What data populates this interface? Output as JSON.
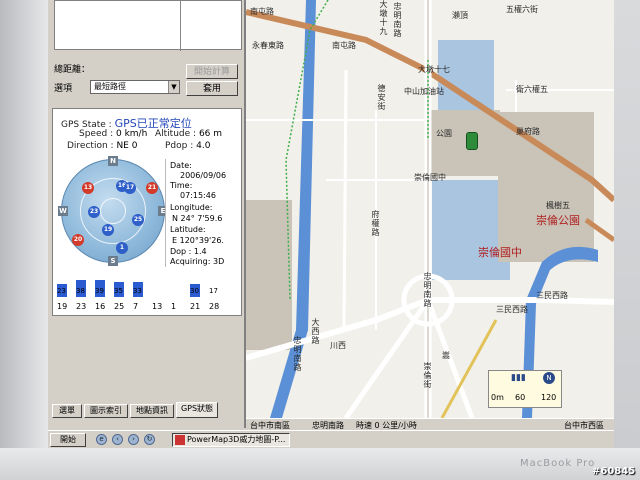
{
  "panel": {
    "route_label": "總距離：",
    "option_label": "選項",
    "option_value": "最短路徑",
    "btn_calc": "開始計算",
    "btn_apply": "套用"
  },
  "gps": {
    "state_label": "GPS State :",
    "state_value": "GPS已正常定位",
    "speed_label": "Speed :",
    "speed_value": "0 km/h",
    "altitude_label": "Altitude :",
    "altitude_value": "66 m",
    "direction_label": "Direction :",
    "direction_value": "NE 0",
    "pdop_label": "Pdop :",
    "pdop_value": "4.0",
    "date_label": "Date:",
    "date_value": "2006/09/06",
    "time_label": "Time:",
    "time_value": "07:15:46",
    "longitude_label": "Longitude:",
    "longitude_value": "N 24° 7'59.6",
    "latitude_label": "Latitude:",
    "latitude_value": "E 120°39'26.",
    "dop_label": "Dop : 1.4",
    "acquiring_label": "Acquiring: 3D",
    "compass": {
      "n": "N",
      "e": "E",
      "s": "S",
      "w": "W"
    },
    "satellites": [
      {
        "id": "13",
        "color": "#d23a2a"
      },
      {
        "id": "16",
        "color": "#2f5fc8"
      },
      {
        "id": "17",
        "color": "#2f5fc8"
      },
      {
        "id": "21",
        "color": "#d23a2a"
      },
      {
        "id": "23",
        "color": "#2f5fc8"
      },
      {
        "id": "25",
        "color": "#2f5fc8"
      },
      {
        "id": "19",
        "color": "#2f5fc8"
      },
      {
        "id": "20",
        "color": "#d23a2a"
      },
      {
        "id": "1",
        "color": "#2f5fc8"
      }
    ],
    "signal": {
      "top_labels": [
        "23",
        "38",
        "39",
        "35",
        "33",
        "30",
        "17"
      ],
      "bottom_labels": [
        "19",
        "23",
        "16",
        "25",
        "7",
        "13",
        "1",
        "21",
        "28"
      ],
      "levels": [
        0.45,
        0.6,
        0.62,
        0.55,
        0.52,
        0,
        0,
        0.48,
        0
      ]
    }
  },
  "tabs": [
    "選單",
    "圖示索引",
    "地點資訊",
    "GPS狀態"
  ],
  "map": {
    "labels": [
      "南屯路",
      "永春東路",
      "南屯路",
      "大墩十九",
      "大墩十七",
      "中山加油站",
      "五權六街",
      "瀨頂",
      "巢府路",
      "德安街",
      "公園",
      "崇倫國中",
      "崇倫國中",
      "崇倫公園",
      "三民西路",
      "三民西路",
      "忠明南路",
      "忠明南路",
      "大西路",
      "川西",
      "嵩",
      "崇倫街",
      "忠明南路",
      "衛六權五",
      "楓樹五",
      "府權路"
    ],
    "scale": {
      "unit1": "0m",
      "unit2": "60",
      "unit3": "120"
    }
  },
  "status": {
    "city": "台中市南區",
    "road": "忠明南路",
    "speed": "時速 0 公里/小時",
    "right": "台中市西區"
  },
  "taskbar": {
    "start": "開始",
    "app": "PowerMap3D威力地圖-P..."
  },
  "device": {
    "brand": "MacBook Pro",
    "watermark": "#60845"
  }
}
